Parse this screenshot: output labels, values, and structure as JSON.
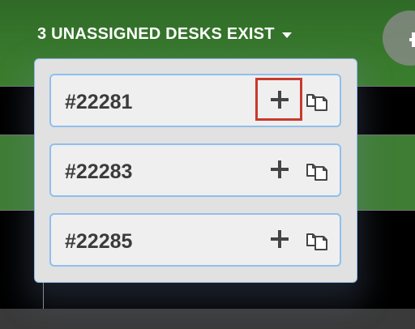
{
  "header": {
    "title": "3 UNASSIGNED DESKS EXIST"
  },
  "desks": [
    {
      "label": "#22281",
      "add_icon": "plus-icon",
      "copy_icon": "copy-icon",
      "highlighted": true
    },
    {
      "label": "#22283",
      "add_icon": "plus-icon",
      "copy_icon": "copy-icon",
      "highlighted": false
    },
    {
      "label": "#22285",
      "add_icon": "plus-icon",
      "copy_icon": "copy-icon",
      "highlighted": false
    }
  ],
  "colors": {
    "background": "#000000",
    "header_green": "#397a2d",
    "row_green": "#3f7d34",
    "panel_bg": "#e1e1e1",
    "row_bg": "#efefef",
    "row_border": "#8fbfed",
    "text_dark": "#3b3b3b",
    "icon_dark": "#444444",
    "highlight_red": "#c73a2c"
  }
}
